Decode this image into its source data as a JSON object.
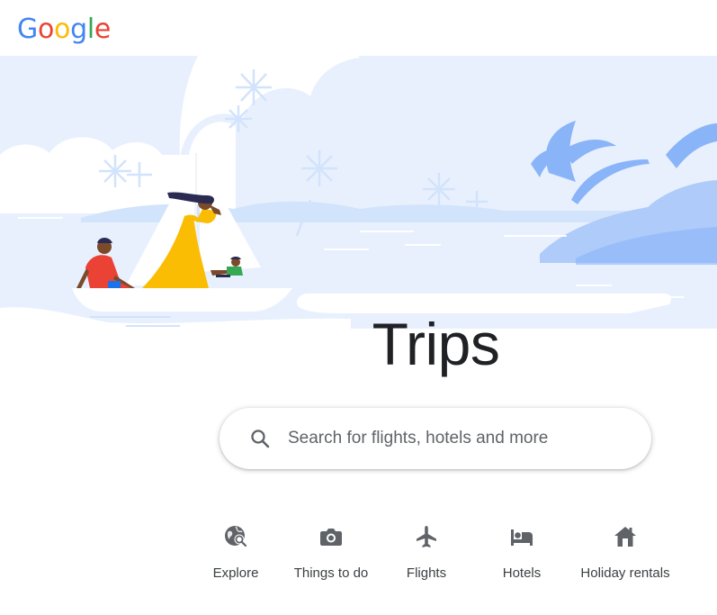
{
  "logo": {
    "letters": [
      "G",
      "o",
      "o",
      "g",
      "l",
      "e"
    ],
    "colors": [
      "#4285F4",
      "#EA4335",
      "#FBBC05",
      "#4285F4",
      "#34A853",
      "#EA4335"
    ]
  },
  "page": {
    "title": "Trips"
  },
  "search": {
    "placeholder": "Search for flights, hotels and more",
    "icon": "search-icon"
  },
  "categories": [
    {
      "label": "Explore",
      "icon": "explore-globe-icon"
    },
    {
      "label": "Things to do",
      "icon": "camera-icon"
    },
    {
      "label": "Flights",
      "icon": "airplane-icon"
    },
    {
      "label": "Hotels",
      "icon": "bed-icon"
    },
    {
      "label": "Holiday rentals",
      "icon": "house-icon"
    }
  ],
  "colors": {
    "text_primary": "#202124",
    "text_secondary": "#3c4043",
    "icon_gray": "#5f6368",
    "hero_sky": "#e8f0fe",
    "hero_accent": "#aecbfa"
  }
}
